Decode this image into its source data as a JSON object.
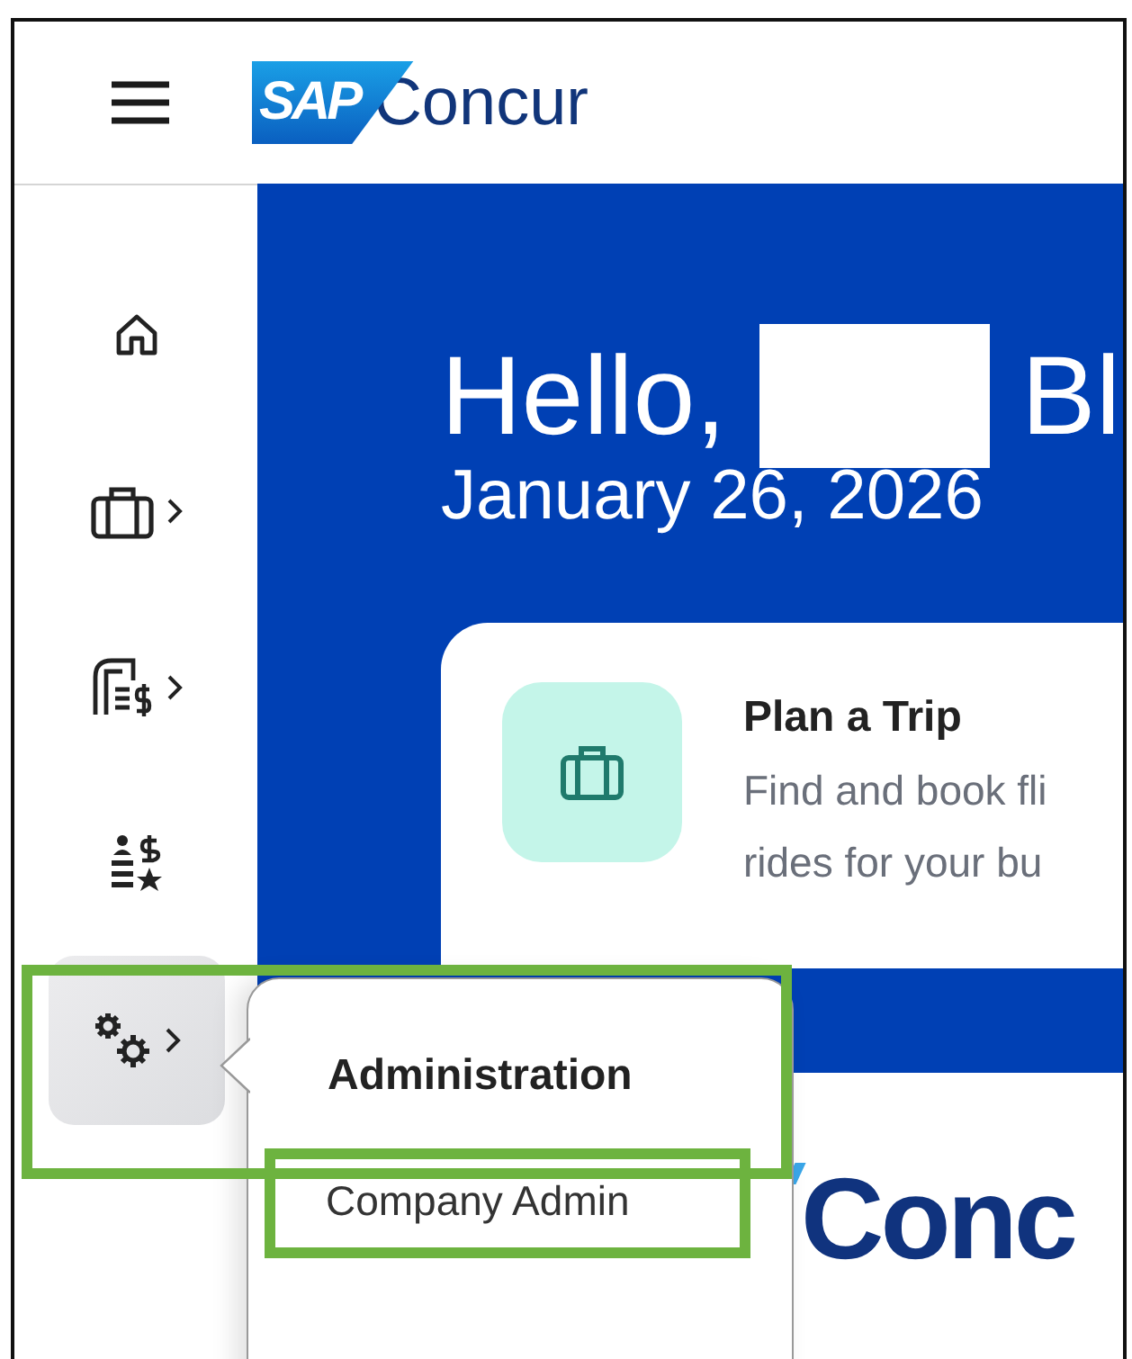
{
  "header": {
    "logo": {
      "brand": "SAP",
      "product": "Concur"
    }
  },
  "sidebar": {
    "items": [
      {
        "kind": "home",
        "has_submenu": false,
        "selected": false
      },
      {
        "kind": "travel",
        "has_submenu": true,
        "selected": false
      },
      {
        "kind": "expense",
        "has_submenu": true,
        "selected": false
      },
      {
        "kind": "approvals",
        "has_submenu": false,
        "selected": false
      },
      {
        "kind": "admin",
        "has_submenu": true,
        "selected": true
      }
    ]
  },
  "banner": {
    "greeting": "Hello,",
    "name_redacted": true,
    "name_tail": "Bl",
    "date": "January 26, 2026"
  },
  "card": {
    "title": "Plan a Trip",
    "description_lines": [
      "Find and book fli",
      "rides for your bu"
    ]
  },
  "footer_logo": {
    "text": "Conc"
  },
  "popover": {
    "title": "Administration",
    "title_highlighted": true,
    "items": [
      {
        "label": "Company Admin",
        "highlighted": true
      }
    ]
  }
}
